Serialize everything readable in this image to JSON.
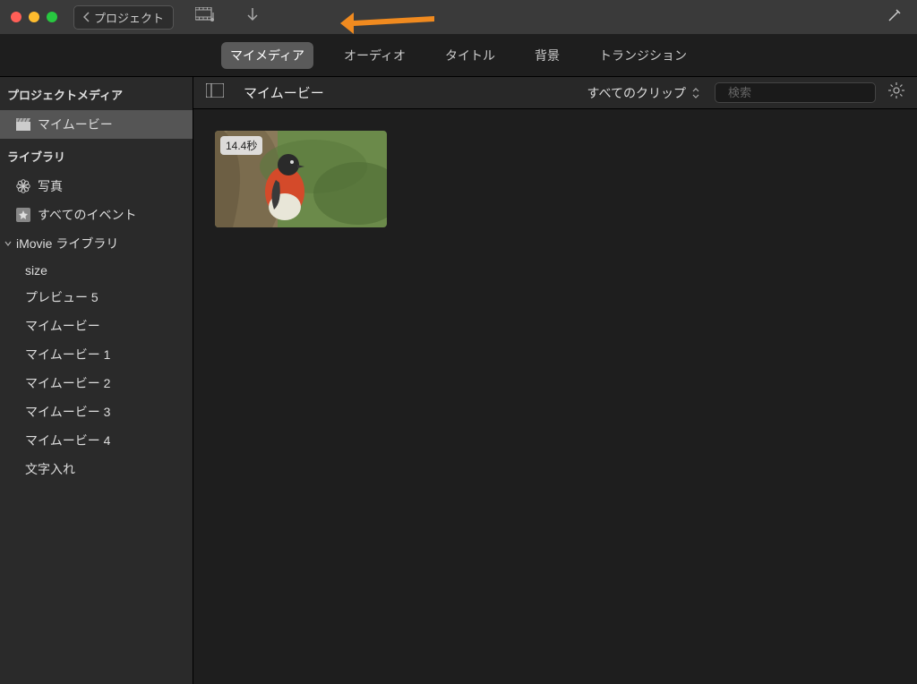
{
  "titlebar": {
    "back_label": "プロジェクト"
  },
  "tabs": [
    {
      "label": "マイメディア",
      "active": true
    },
    {
      "label": "オーディオ",
      "active": false
    },
    {
      "label": "タイトル",
      "active": false
    },
    {
      "label": "背景",
      "active": false
    },
    {
      "label": "トランジション",
      "active": false
    }
  ],
  "sidebar": {
    "section_project": "プロジェクトメディア",
    "project_item": "マイムービー",
    "section_library": "ライブラリ",
    "photos_label": "写真",
    "all_events_label": "すべてのイベント",
    "imovie_library_label": "iMovie ライブラリ",
    "library_items": [
      "size",
      "プレビュー 5",
      "マイムービー",
      "マイムービー 1",
      "マイムービー 2",
      "マイムービー 3",
      "マイムービー 4",
      "文字入れ"
    ]
  },
  "content": {
    "title": "マイムービー",
    "clip_filter": "すべてのクリップ",
    "search_placeholder": "検索"
  },
  "clips": [
    {
      "duration": "14.4秒"
    }
  ]
}
